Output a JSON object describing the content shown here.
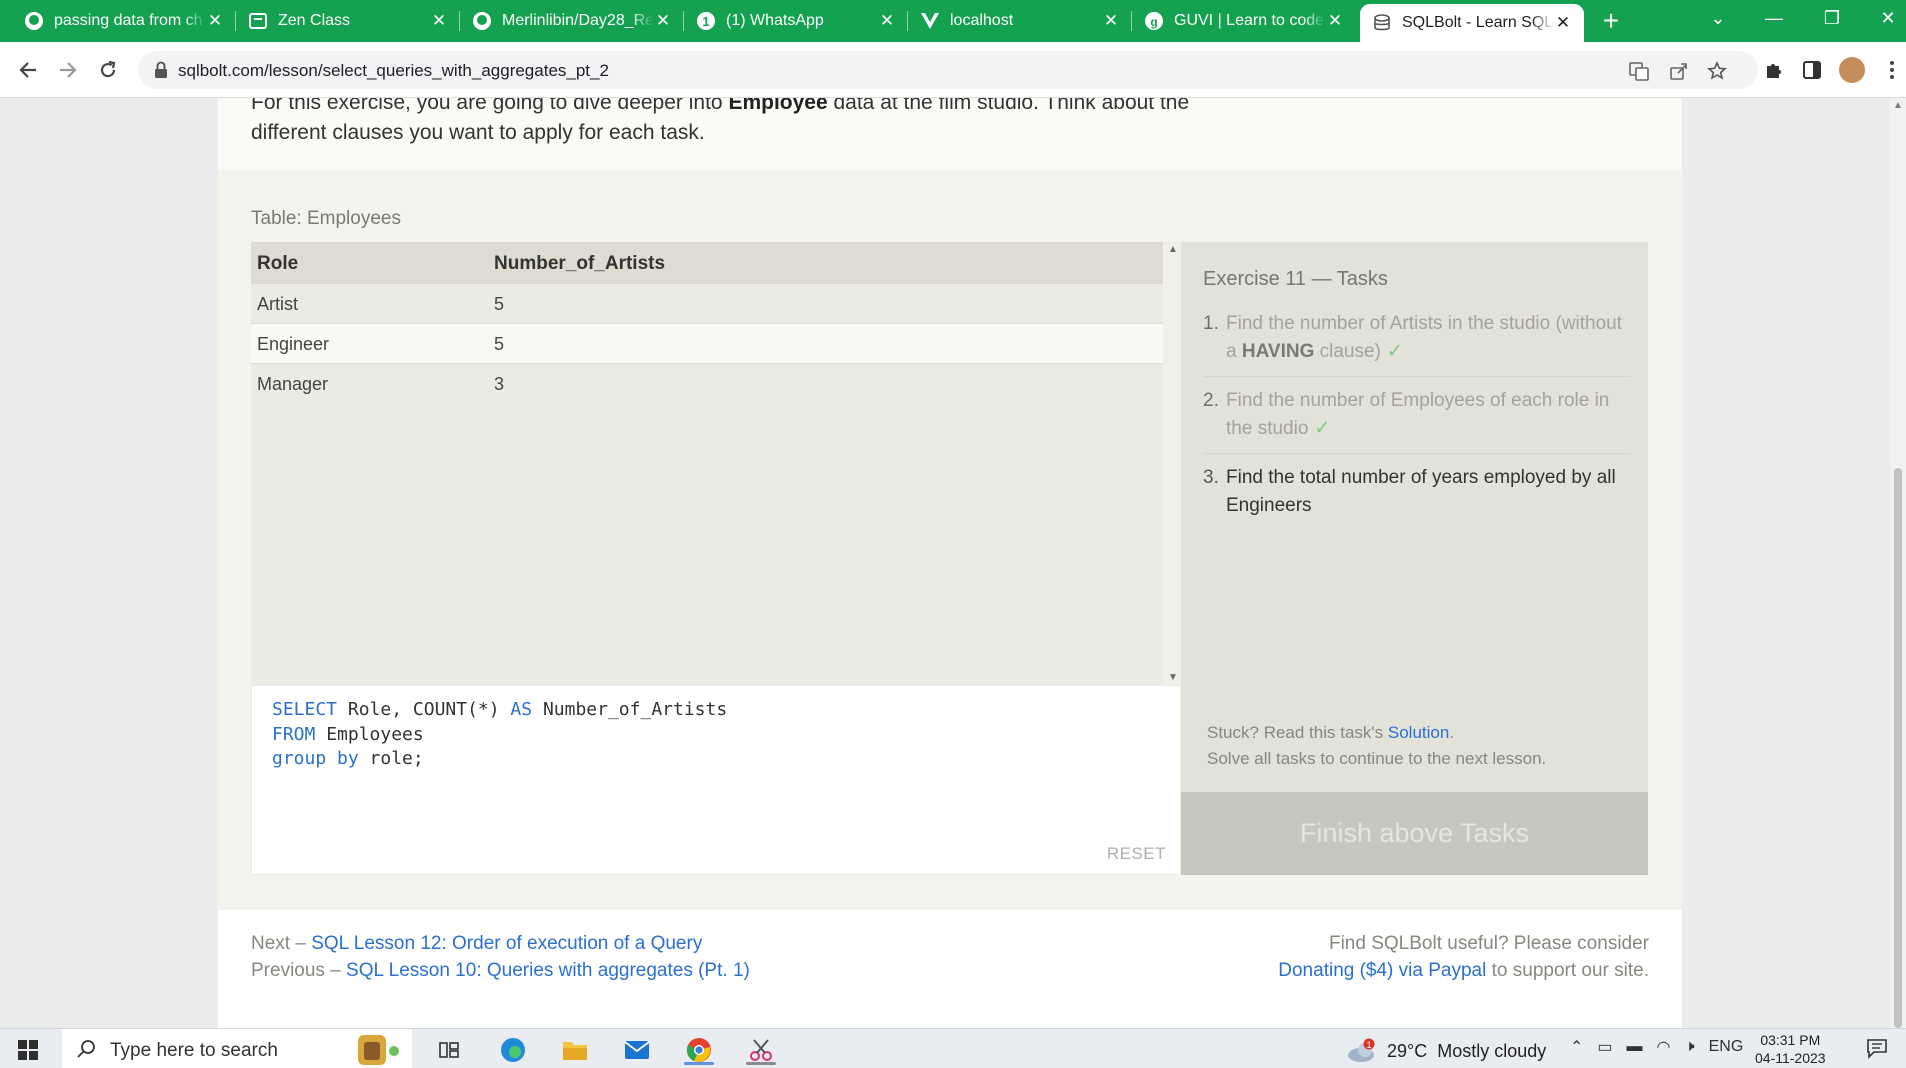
{
  "browser": {
    "tabs": [
      {
        "title": "passing data from ch",
        "icon": "github-icon"
      },
      {
        "title": "Zen Class",
        "icon": "document-icon"
      },
      {
        "title": "Merlinlibin/Day28_Re",
        "icon": "github-icon"
      },
      {
        "title": "(1) WhatsApp",
        "icon": "whatsapp-icon",
        "badge": "1"
      },
      {
        "title": "localhost",
        "icon": "vue-icon"
      },
      {
        "title": "GUVI | Learn to code",
        "icon": "guvi-icon"
      },
      {
        "title": "SQLBolt - Learn SQL",
        "icon": "database-icon",
        "active": true
      }
    ],
    "url": "sqlbolt.com/lesson/select_queries_with_aggregates_pt_2",
    "theme_color": "#14a150"
  },
  "intro": {
    "part1": "For this exercise, you are going to dive deeper into ",
    "bold": "Employee",
    "part2": " data at the film studio. Think about the different clauses you want to apply for each task."
  },
  "table": {
    "label": "Table: Employees",
    "columns": [
      "Role",
      "Number_of_Artists"
    ],
    "rows": [
      [
        "Artist",
        "5"
      ],
      [
        "Engineer",
        "5"
      ],
      [
        "Manager",
        "3"
      ]
    ]
  },
  "editor": {
    "lines": [
      {
        "kw": "SELECT",
        "text": " Role, COUNT(*) ",
        "kw2": "AS",
        "text2": " Number_of_Artists"
      },
      {
        "kw": "FROM",
        "text": " Employees"
      },
      {
        "kw": "group by",
        "text": " role;"
      }
    ],
    "reset_label": "RESET"
  },
  "tasks": {
    "title": "Exercise 11 — Tasks",
    "items": [
      {
        "num": "1.",
        "text_a": "Find the number of Artists in the studio (without a ",
        "bold": "HAVING",
        "text_b": " clause)",
        "check": "✓",
        "status": "done"
      },
      {
        "num": "2.",
        "text_a": "Find the number of Employees of each role in the studio",
        "check": "✓",
        "status": "done"
      },
      {
        "num": "3.",
        "text_a": "Find the total number of years employed by all Engineers",
        "status": "current"
      }
    ],
    "stuck_prefix": "Stuck? Read this task's ",
    "solution_link": "Solution",
    "stuck_suffix": ".",
    "continue_text": "Solve all tasks to continue to the next lesson.",
    "finish_button": "Finish above Tasks"
  },
  "pager": {
    "next_prefix": "Next – ",
    "next_link": "SQL Lesson 12: Order of execution of a Query",
    "prev_prefix": "Previous – ",
    "prev_link": "SQL Lesson 10: Queries with aggregates (Pt. 1)",
    "support_line1": "Find SQLBolt useful? Please consider",
    "donate_link": "Donating ($4) via Paypal",
    "support_suffix": " to support our site."
  },
  "taskbar": {
    "search_placeholder": "Type here to search",
    "weather": "29°C  Mostly cloudy",
    "weather_badge": "1",
    "language": "ENG",
    "time": "03:31 PM",
    "date": "04-11-2023"
  }
}
